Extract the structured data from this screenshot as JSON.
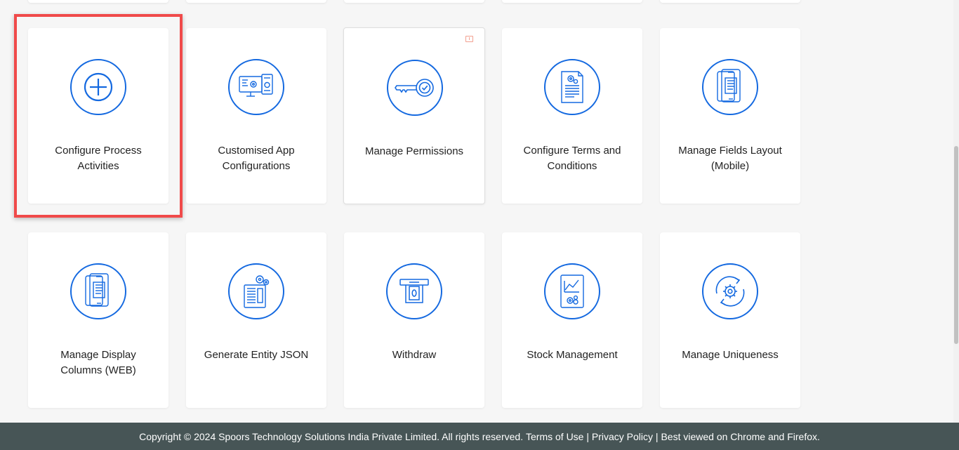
{
  "cards": [
    {
      "id": "configure-process-activities",
      "label": "Configure Process\nActivities",
      "icon": "plus-circle-icon"
    },
    {
      "id": "customised-app-configurations",
      "label": "Customised App\nConfigurations",
      "icon": "devices-settings-icon"
    },
    {
      "id": "manage-permissions",
      "label": "Manage Permissions",
      "icon": "key-icon"
    },
    {
      "id": "configure-terms-and-conditions",
      "label": "Configure Terms and\nConditions",
      "icon": "document-settings-icon"
    },
    {
      "id": "manage-fields-layout-mobile",
      "label": "Manage Fields Layout\n(Mobile)",
      "icon": "mobile-document-icon"
    },
    {
      "id": "manage-display-columns-web",
      "label": "Manage Display\nColumns (WEB)",
      "icon": "mobile-document-icon"
    },
    {
      "id": "generate-entity-json",
      "label": "Generate Entity JSON",
      "icon": "document-gears-icon"
    },
    {
      "id": "withdraw",
      "label": "Withdraw",
      "icon": "atm-withdraw-icon"
    },
    {
      "id": "stock-management",
      "label": "Stock Management",
      "icon": "chart-document-icon"
    },
    {
      "id": "manage-uniqueness",
      "label": "Manage Uniqueness",
      "icon": "gear-refresh-icon"
    }
  ],
  "footer": {
    "copyright": "Copyright © 2024 Spoors Technology Solutions India Private Limited. All rights reserved. ",
    "terms": "Terms of Use",
    "sep1": " | ",
    "privacy": "Privacy Policy",
    "sep2": " | ",
    "browsers": "Best viewed on Chrome and Firefox."
  },
  "colors": {
    "accent": "#1469e0",
    "highlight": "#f04a4a",
    "footer_bg": "#475556"
  }
}
